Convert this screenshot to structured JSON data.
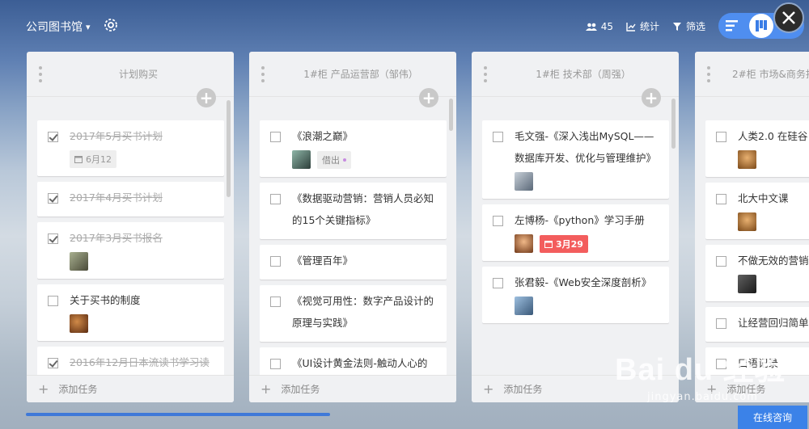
{
  "topbar": {
    "library_name": "公司图书馆",
    "member_count": "45",
    "stats_label": "统计",
    "filter_label": "筛选"
  },
  "columns": [
    {
      "title": "计划购买",
      "cards": [
        {
          "text": "2017年5月买书计划",
          "done": true,
          "date": "6月12",
          "date_overdue": false
        },
        {
          "text": "2017年4月买书计划",
          "done": true
        },
        {
          "text": "2017年3月买书报名",
          "done": true,
          "avatar": "avatar-1"
        },
        {
          "text": "关于买书的制度",
          "done": false,
          "avatar": "avatar-2"
        },
        {
          "text": "2016年12月日本流读书学习读",
          "done": true
        }
      ],
      "add_label": "添加任务"
    },
    {
      "title": "1#柜 产品运营部（邹伟）",
      "cards": [
        {
          "text": "《浪潮之巅》",
          "done": false,
          "avatar": "avatar-3",
          "tag": "借出"
        },
        {
          "text": "《数据驱动营销：营销人员必知的15个关键指标》",
          "done": false
        },
        {
          "text": "《管理百年》",
          "done": false
        },
        {
          "text": "《视觉可用性：数字产品设计的原理与实践》",
          "done": false
        },
        {
          "text": "《UI设计黄金法则-触动人心的",
          "done": false
        }
      ],
      "add_label": "添加任务"
    },
    {
      "title": "1#柜 技术部（周强）",
      "cards": [
        {
          "text": "毛文强-《深入浅出MySQL——数据库开发、优化与管理维护》",
          "done": false,
          "avatar": "avatar-4"
        },
        {
          "text": "左博杨-《python》学习手册",
          "done": false,
          "avatar": "avatar-5",
          "date": "3月29",
          "date_overdue": true
        },
        {
          "text": "张君毅-《Web安全深度剖析》",
          "done": false,
          "avatar": "avatar-6"
        }
      ],
      "add_label": "添加任务"
    },
    {
      "title": "2#柜 市场&商务拓",
      "cards": [
        {
          "text": "人类2.0 在硅谷",
          "done": false,
          "avatar": "avatar-7"
        },
        {
          "text": "北大中文课",
          "done": false,
          "avatar": "avatar-7"
        },
        {
          "text": "不做无效的营销",
          "done": false,
          "avatar": "avatar-8"
        },
        {
          "text": "让经营回归简单",
          "done": false
        },
        {
          "text": "口语记录",
          "done": false
        }
      ],
      "add_label": "添加任务"
    }
  ],
  "consult_button": "在线咨询",
  "watermark": {
    "main": "Bai du 经验",
    "sub": "jingyan.baidu.com"
  },
  "colors": {
    "accent": "#4f8ef0",
    "overdue": "#f35d5d"
  }
}
